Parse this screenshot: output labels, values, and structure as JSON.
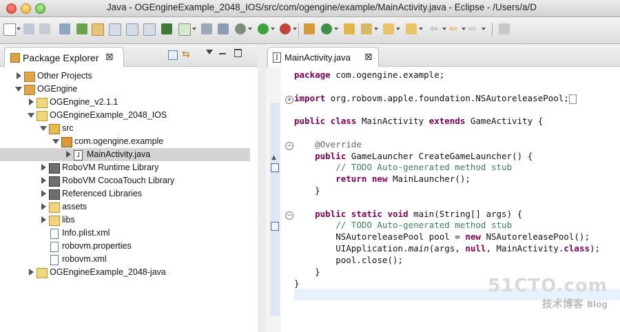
{
  "window": {
    "title": "Java - OGEngineExample_2048_IOS/src/com/ogengine/example/MainActivity.java - Eclipse - /Users/a/D"
  },
  "package_explorer": {
    "tab_label": "Package Explorer",
    "tree": [
      {
        "label": "Other Projects",
        "icon": "working-set-icon",
        "expanded": false
      },
      {
        "label": "OGEngine",
        "icon": "working-set-icon",
        "expanded": true
      },
      {
        "label": "OGEngine_v2.1.1",
        "icon": "project-icon",
        "expanded": false
      },
      {
        "label": "OGEngineExample_2048_IOS",
        "icon": "project-icon",
        "expanded": true
      },
      {
        "label": "src",
        "icon": "source-folder-icon",
        "expanded": true
      },
      {
        "label": "com.ogengine.example",
        "icon": "package-icon",
        "expanded": true
      },
      {
        "label": "MainActivity.java",
        "icon": "java-file-icon",
        "expanded": false,
        "selected": true
      },
      {
        "label": "RoboVM Runtime Library",
        "icon": "library-icon",
        "expanded": false
      },
      {
        "label": "RoboVM CocoaTouch Library",
        "icon": "library-icon",
        "expanded": false
      },
      {
        "label": "Referenced Libraries",
        "icon": "library-icon",
        "expanded": false
      },
      {
        "label": "assets",
        "icon": "folder-icon",
        "expanded": false
      },
      {
        "label": "libs",
        "icon": "folder-icon",
        "expanded": false
      },
      {
        "label": "Info.plist.xml",
        "icon": "xml-file-icon"
      },
      {
        "label": "robovm.properties",
        "icon": "properties-file-icon"
      },
      {
        "label": "robovm.xml",
        "icon": "xml-file-icon"
      },
      {
        "label": "OGEngineExample_2048-java",
        "icon": "project-icon",
        "expanded": false
      }
    ]
  },
  "editor": {
    "tab_label": "MainActivity.java",
    "code": {
      "l1": "package com.ogengine.example;",
      "l2": "import org.robovm.apple.foundation.NSAutoreleasePool;",
      "l3": "public class MainActivity extends GameActivity {",
      "l4": "@Override",
      "l5": "public GameLauncher CreateGameLauncher() {",
      "l6": "// TODO Auto-generated method stub",
      "l7": "return new MainLauncher();",
      "l8": "}",
      "l9": "public static void main(String[] args) {",
      "l10": "// TODO Auto-generated method stub",
      "l11": "NSAutoreleasePool pool = new NSAutoreleasePool();",
      "l12": "UIApplication.main(args, null, MainActivity.class);",
      "l13": "pool.close();",
      "l14": "}",
      "l15": "}"
    }
  },
  "watermark": {
    "main": "51CTO.com",
    "sub": "技术博客",
    "blog": "Blog"
  }
}
